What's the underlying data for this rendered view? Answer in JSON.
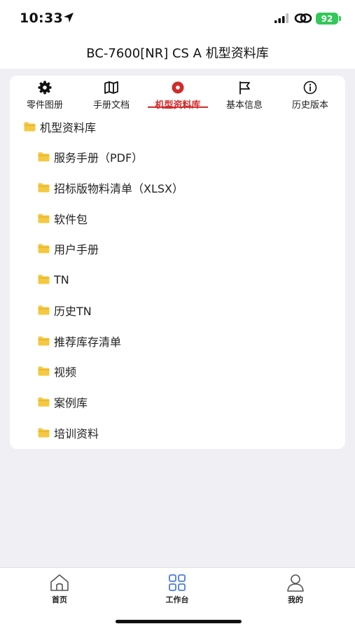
{
  "status": {
    "time": "10:33",
    "battery": "92"
  },
  "header": {
    "title": "BC-7600[NR] CS A 机型资料库"
  },
  "tabs": [
    {
      "label": "零件图册",
      "icon": "gear-icon"
    },
    {
      "label": "手册文档",
      "icon": "map-icon"
    },
    {
      "label": "机型资料库",
      "icon": "record-icon",
      "active": true
    },
    {
      "label": "基本信息",
      "icon": "flag-icon"
    },
    {
      "label": "历史版本",
      "icon": "info-icon"
    }
  ],
  "tree": {
    "root": "机型资料库",
    "children": [
      "服务手册（PDF）",
      "招标版物料清单（XLSX）",
      "软件包",
      "用户手册",
      "TN",
      "历史TN",
      "推荐库存清单",
      "视频",
      "案例库",
      "培训资料"
    ]
  },
  "bottom_nav": [
    {
      "label": "首页",
      "icon": "home-icon"
    },
    {
      "label": "工作台",
      "icon": "grid-icon"
    },
    {
      "label": "我的",
      "icon": "person-icon"
    }
  ],
  "colors": {
    "accent": "#d22b2b",
    "folder": "#f5c842",
    "workbench_icon": "#4a7fd8",
    "battery": "#34c759"
  }
}
